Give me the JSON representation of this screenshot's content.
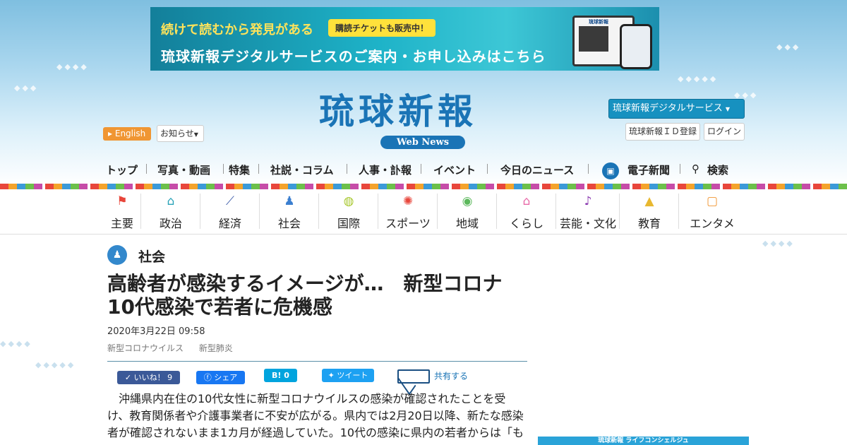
{
  "banner": {
    "line1": "続けて読むから発見がある",
    "pill": "購読チケットも販売中！",
    "line2": "琉球新報デジタルサービスのご案内・お申し込みはこちら",
    "device_title": "琉球新報"
  },
  "header": {
    "logo": "琉球新報",
    "logo_sub": "Web News",
    "english": "English",
    "notice": "お知らせ",
    "digital_service": "琉球新報デジタルサービス",
    "id_register": "琉球新報ＩＤ登録",
    "login": "ログイン"
  },
  "global_nav": {
    "items": [
      "トップ",
      "写真・動画",
      "特集",
      "社説・コラム",
      "人事・訃報",
      "イベント",
      "今日のニュース",
      "電子新聞",
      "検索"
    ]
  },
  "category_nav": {
    "items": [
      {
        "label": "主要",
        "icon": "flag-icon",
        "color": "#e8463b"
      },
      {
        "label": "政治",
        "icon": "parliament-icon",
        "color": "#2aa3b8"
      },
      {
        "label": "経済",
        "icon": "chart-line-icon",
        "color": "#3b5aa8"
      },
      {
        "label": "社会",
        "icon": "people-icon",
        "color": "#3b7fd0"
      },
      {
        "label": "国際",
        "icon": "globe-icon",
        "color": "#a8c830"
      },
      {
        "label": "スポーツ",
        "icon": "runner-icon",
        "color": "#e8463b"
      },
      {
        "label": "地域",
        "icon": "map-pin-icon",
        "color": "#5cb85c"
      },
      {
        "label": "くらし",
        "icon": "house-icon",
        "color": "#e86aa8"
      },
      {
        "label": "芸能・文化",
        "icon": "sanshin-icon",
        "color": "#8a3ab0"
      },
      {
        "label": "教育",
        "icon": "graduation-cap-icon",
        "color": "#e8b830"
      },
      {
        "label": "エンタメ",
        "icon": "tv-icon",
        "color": "#f09633"
      }
    ]
  },
  "article": {
    "section": "社会",
    "title_line1": "高齢者が感染するイメージが…　新型コロナ",
    "title_line2": "10代感染で若者に危機感",
    "date": "2020年3月22日 09:58",
    "tags": [
      "新型コロナウイルス",
      "新型肺炎"
    ],
    "body": "沖縄県内在住の10代女性に新型コロナウイルスの感染が確認されたことを受け、教育関係者や介護事業者に不安が広がる。県内では2月20日以降、新たな感染者が確認されないまま1カ月が経過していた。10代の感染に県内の若者からは「も"
  },
  "share": {
    "like": "いいね！ 9",
    "facebook": "シェア",
    "hatena": "B! 0",
    "tweet": "ツイート",
    "mail": "共有する"
  },
  "sidebar": {
    "concierge": "琉球新報 ライフコンシェルジュ"
  }
}
